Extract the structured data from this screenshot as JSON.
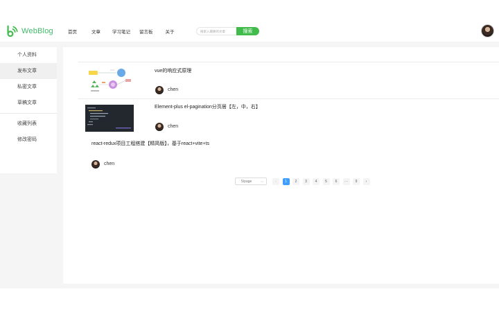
{
  "app": {
    "logo_text": "WebBlog"
  },
  "nav": {
    "items": [
      "首页",
      "文章",
      "学习笔记",
      "留言板",
      "关于"
    ]
  },
  "search": {
    "placeholder": "搜索入输要的文章",
    "button": "搜索"
  },
  "sidebar": {
    "items": [
      "个人资料",
      "发布文章",
      "私密文章",
      "草稿文章",
      "收藏列表",
      "修改密码"
    ],
    "active_index": 1
  },
  "articles": [
    {
      "title": "vue的响应式原理",
      "author": "chen",
      "thumbnail": "diagram-thumbnail"
    },
    {
      "title": "Element-plus el-pagination分页居【左，中，右】",
      "author": "chen",
      "thumbnail": "code-thumbnail"
    },
    {
      "title": "react-redux项目工程搭建【精简版】，基于react+vite+ts",
      "author": "chen",
      "thumbnail": ""
    }
  ],
  "pagination": {
    "page_size_label": "5/page",
    "prev": "‹",
    "pages": [
      "1",
      "2",
      "3",
      "4",
      "5",
      "6",
      "···",
      "9"
    ],
    "current": "1",
    "next": "›"
  },
  "colors": {
    "brand": "#41bb4c",
    "pagination_active": "#409eff",
    "backdrop": "#f5f5f5"
  },
  "icons": {
    "logo": "webblog-logo-icon",
    "delete": "trash-icon",
    "dropdown": "chevron-down-icon"
  }
}
